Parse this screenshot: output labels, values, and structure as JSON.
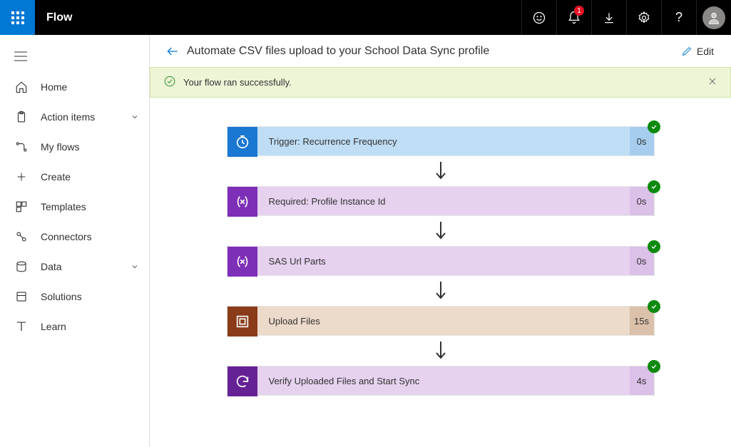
{
  "topbar": {
    "brand": "Flow",
    "notification_count": "1"
  },
  "nav": {
    "items": [
      {
        "label": "Home"
      },
      {
        "label": "Action items",
        "expandable": true
      },
      {
        "label": "My flows"
      },
      {
        "label": "Create"
      },
      {
        "label": "Templates"
      },
      {
        "label": "Connectors"
      },
      {
        "label": "Data",
        "expandable": true
      },
      {
        "label": "Solutions"
      },
      {
        "label": "Learn"
      }
    ]
  },
  "header": {
    "title": "Automate CSV files upload to your School Data Sync profile",
    "edit_label": "Edit"
  },
  "banner": {
    "message": "Your flow ran successfully."
  },
  "steps": [
    {
      "label": "Trigger: Recurrence Frequency",
      "duration": "0s",
      "variant": "blue",
      "icon": "clock"
    },
    {
      "label": "Required: Profile Instance Id",
      "duration": "0s",
      "variant": "purple",
      "icon": "var"
    },
    {
      "label": "SAS Url Parts",
      "duration": "0s",
      "variant": "purple",
      "icon": "var"
    },
    {
      "label": "Upload Files",
      "duration": "15s",
      "variant": "brown",
      "icon": "container"
    },
    {
      "label": "Verify Uploaded Files and Start Sync",
      "duration": "4s",
      "variant": "purple2",
      "icon": "sync"
    }
  ]
}
